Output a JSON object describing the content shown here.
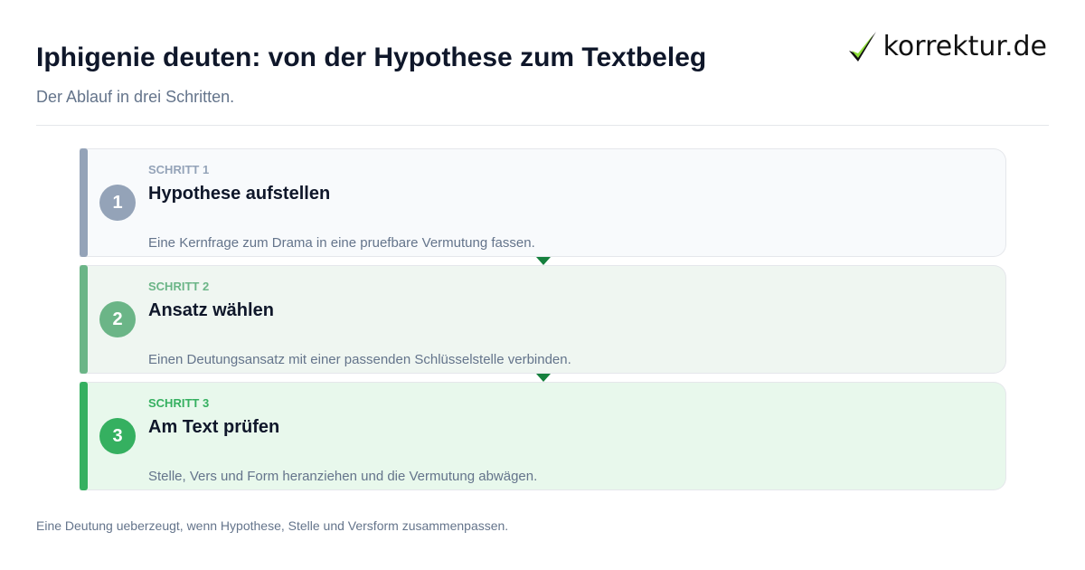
{
  "header": {
    "title": "Iphigenie deuten: von der Hypothese zum Textbeleg",
    "subtitle": "Der Ablauf in drei Schritten."
  },
  "logo": {
    "text": "korrektur.de",
    "icon": "checkmark-icon"
  },
  "steps": [
    {
      "number": "1",
      "label": "SCHRITT 1",
      "heading": "Hypothese aufstellen",
      "description": "Eine Kernfrage zum Drama in eine pruefbare Vermutung fassen.",
      "accent": "#94a3b8",
      "background": "#f8fafc"
    },
    {
      "number": "2",
      "label": "SCHRITT 2",
      "heading": "Ansatz wählen",
      "description": "Einen Deutungsansatz mit einer passenden Schlüsselstelle verbinden.",
      "accent": "#6bb587",
      "background": "#eff6f1"
    },
    {
      "number": "3",
      "label": "SCHRITT 3",
      "heading": "Am Text prüfen",
      "description": "Stelle, Vers und Form heranziehen und die Vermutung abwägen.",
      "accent": "#35b060",
      "background": "#e8f8ec"
    }
  ],
  "connector_color": "#15803d",
  "footer": {
    "note": "Eine Deutung ueberzeugt, wenn Hypothese, Stelle und Versform zusammenpassen."
  }
}
